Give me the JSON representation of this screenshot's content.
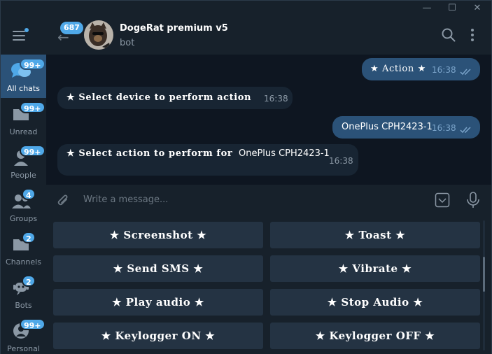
{
  "window": {
    "controls": [
      "minimize-icon",
      "maximize-icon",
      "close-icon"
    ],
    "min_glyph": "—",
    "max_glyph": "☐",
    "close_glyph": "✕"
  },
  "sidebar": {
    "items": [
      {
        "label": "All chats",
        "badge": "99+",
        "icon": "chat-bubbles-icon",
        "active": true
      },
      {
        "label": "Unread",
        "badge": "99+",
        "icon": "folder-icon"
      },
      {
        "label": "People",
        "badge": "99+",
        "icon": "person-icon"
      },
      {
        "label": "Groups",
        "badge": "4",
        "icon": "group-icon"
      },
      {
        "label": "Channels",
        "badge": "2",
        "icon": "folder-icon"
      },
      {
        "label": "Bots",
        "badge": "2",
        "icon": "bot-icon"
      },
      {
        "label": "Personal",
        "badge": "99+",
        "icon": "person-icon"
      }
    ]
  },
  "header": {
    "back_badge": "687",
    "title": "DogeRat premium v5",
    "status": "bot"
  },
  "messages": [
    {
      "dir": "out",
      "text": "★ Action ★",
      "time": "16:38"
    },
    {
      "dir": "in",
      "text": "★ Select device to perform action",
      "time": "16:38"
    },
    {
      "dir": "out",
      "text": "OnePlus CPH2423-1",
      "time": "16:38"
    },
    {
      "dir": "in",
      "text": "★ Select action to perform for ",
      "text_tail": "OnePlus CPH2423-1",
      "time": "16:38"
    }
  ],
  "composer": {
    "placeholder": "Write a message..."
  },
  "keyboard": {
    "buttons": [
      "★ Screenshot ★",
      "★ Toast ★",
      "★ Send SMS ★",
      "★ Vibrate ★",
      "★ Play audio ★",
      "★ Stop Audio ★",
      "★ Keylogger ON ★",
      "★ Keylogger OFF ★"
    ]
  },
  "colors": {
    "accent": "#4fa8e8",
    "outgoing_bubble": "#2b5278",
    "incoming_bubble": "#182533",
    "panel": "#17212b",
    "background": "#0e1621"
  }
}
